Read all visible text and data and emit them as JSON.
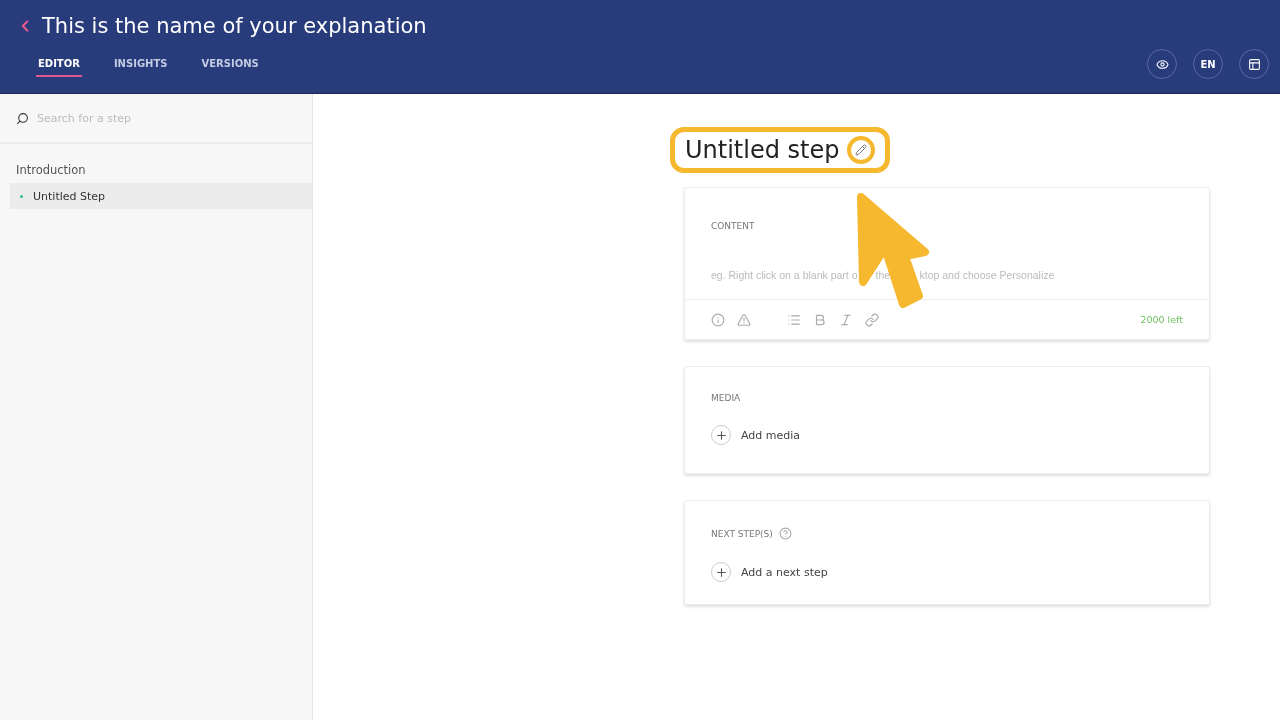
{
  "header": {
    "title": "This is the name of your explanation",
    "tabs": [
      {
        "label": "EDITOR",
        "selected": true
      },
      {
        "label": "INSIGHTS",
        "selected": false
      },
      {
        "label": "VERSIONS",
        "selected": false
      }
    ],
    "language": "EN"
  },
  "sidebar": {
    "search": {
      "placeholder": "Search for a step"
    },
    "sections": [
      {
        "title": "Introduction",
        "items": [
          {
            "label": "Untitled Step",
            "selected": true
          }
        ]
      }
    ]
  },
  "step": {
    "title": "Untitled step"
  },
  "cards": [
    {
      "kind": "content",
      "label": "CONTENT",
      "placeholder_parts": [
        "eg. Right click on a blank part o",
        "the",
        "ktop and choose Personalize"
      ],
      "counter": "2000 left"
    },
    {
      "kind": "media",
      "label": "MEDIA",
      "action": "Add media"
    },
    {
      "kind": "next",
      "label": "NEXT STEP(S)",
      "action": "Add a next step"
    }
  ]
}
